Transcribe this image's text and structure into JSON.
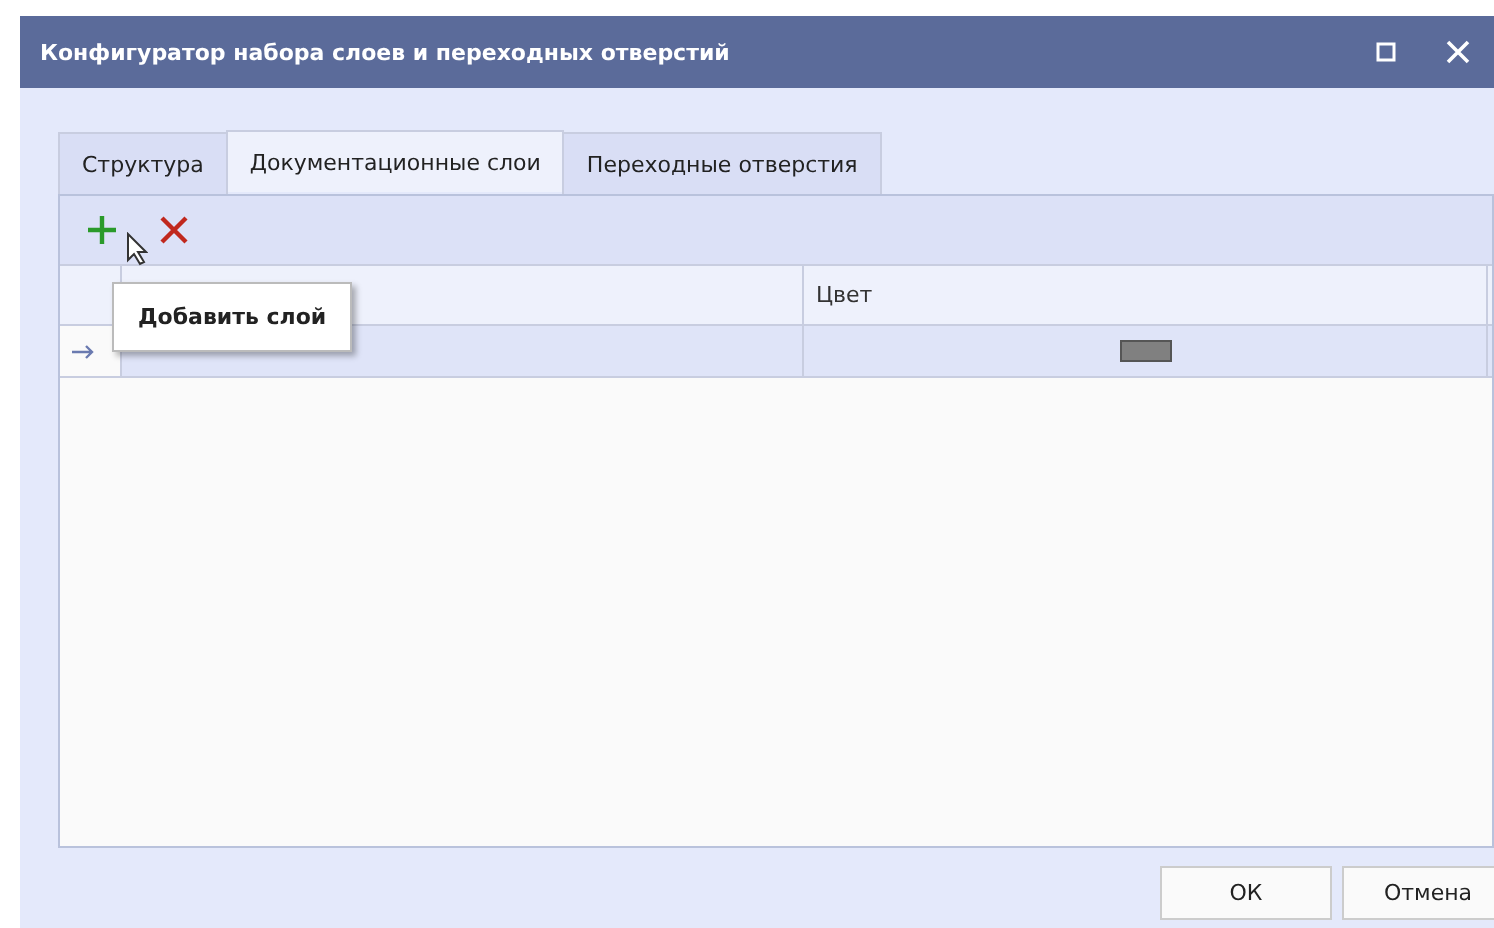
{
  "window": {
    "title": "Конфигуратор набора слоев и переходных отверстий"
  },
  "tabs": [
    {
      "label": "Структура",
      "selected": false
    },
    {
      "label": "Документационные слои",
      "selected": true
    },
    {
      "label": "Переходные отверстия",
      "selected": false
    }
  ],
  "toolbar": {
    "tooltip": "Добавить слой"
  },
  "table": {
    "columns": [
      {
        "label": "Цвет"
      }
    ],
    "rows": [
      {
        "selected": true,
        "color": "#808080"
      }
    ]
  },
  "buttons": [
    "ОК",
    "Отмена"
  ]
}
